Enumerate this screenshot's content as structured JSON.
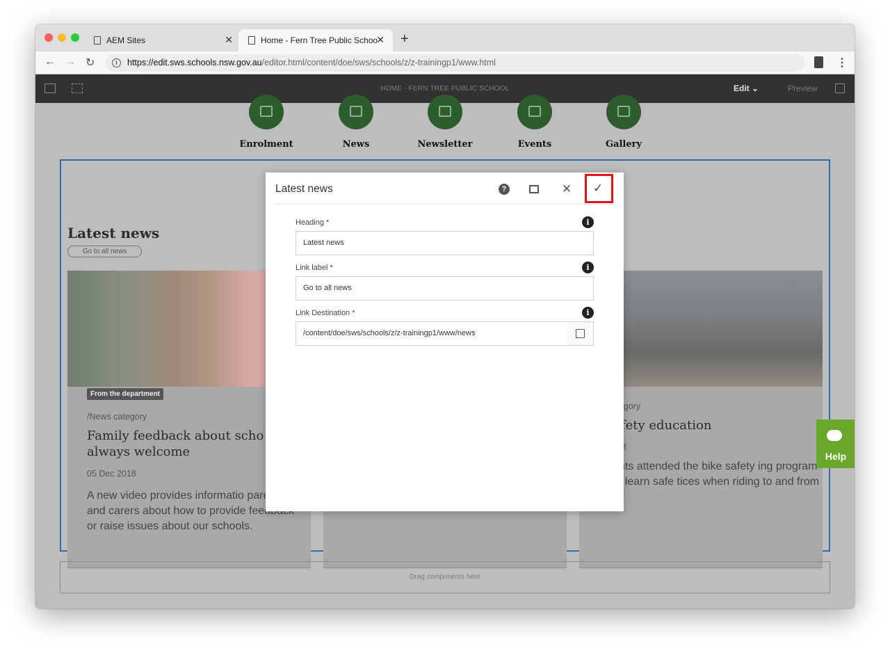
{
  "browser": {
    "tabs": [
      {
        "label": "AEM Sites"
      },
      {
        "label": "Home - Fern Tree Public Schoo"
      }
    ],
    "url_host": "https://edit.sws.schools.nsw.gov.au",
    "url_path": "/editor.html/content/doe/sws/schools/z/z-trainingp1/www.html"
  },
  "aem_toolbar": {
    "page_title": "HOME - FERN TREE PUBLIC SCHOOL",
    "mode_label": "Edit",
    "preview_label": "Preview"
  },
  "quicklinks": [
    {
      "label": "Enrolment",
      "icon": "pencil-icon"
    },
    {
      "label": "News",
      "icon": "news-icon"
    },
    {
      "label": "Newsletter",
      "icon": "newsletter-icon"
    },
    {
      "label": "Events",
      "icon": "calendar-icon"
    },
    {
      "label": "Gallery",
      "icon": "gallery-icon"
    }
  ],
  "news_section": {
    "heading": "Latest news",
    "link_label": "Go to all news",
    "cards": [
      {
        "badge": "From the department",
        "category": "/News category",
        "title": "Family feedback about scho always welcome",
        "date": "05 Dec 2018",
        "description": "A new video provides informatio parents and carers about how to provide feedback or raise issues about our schools."
      },
      {
        "category": "category",
        "title": "safety education",
        "date": "2018",
        "description": "ents attended the bike safety ing program to learn safe tices when riding to and from ol."
      }
    ]
  },
  "drop_zone": {
    "label": "Drag components here"
  },
  "help_tab": {
    "label": "Help"
  },
  "dialog": {
    "title": "Latest news",
    "fields": [
      {
        "label": "Heading *",
        "value": "Latest news"
      },
      {
        "label": "Link label *",
        "value": "Go to all news"
      },
      {
        "label": "Link Destination *",
        "value": "/content/doe/sws/schools/z/z-trainingp1/www/news"
      }
    ]
  },
  "colors": {
    "accent_green": "#2d5c2d",
    "help_green": "#69a82b",
    "highlight_red": "#e2121d",
    "section_blue": "#2f6cb5"
  }
}
